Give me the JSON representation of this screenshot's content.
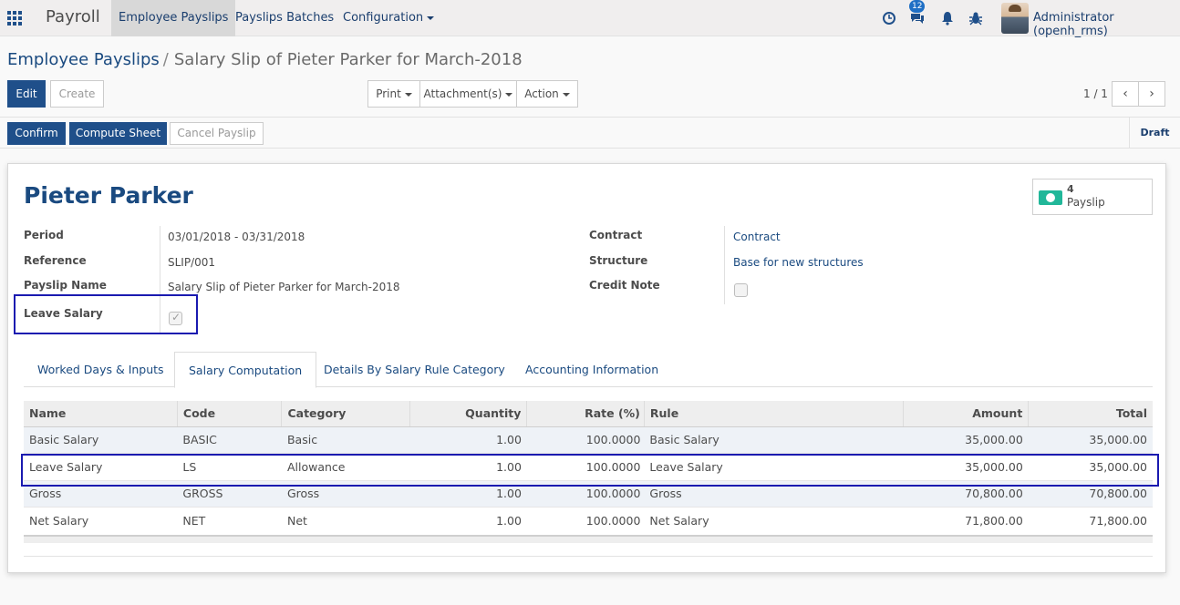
{
  "navbar": {
    "brand": "Payroll",
    "menus": [
      {
        "label": "Employee Payslips",
        "active": true
      },
      {
        "label": "Payslips Batches",
        "active": false
      },
      {
        "label": "Configuration",
        "dropdown": true
      }
    ],
    "icons": [
      "apps-grid-icon",
      "clock-icon",
      "chat-icon",
      "bell-icon",
      "bug-icon"
    ],
    "chat_badge": "12",
    "user": "Administrator (openh_rms)"
  },
  "breadcrumb": {
    "parent": "Employee Payslips",
    "separator": "/",
    "current": "Salary Slip of Pieter Parker for March-2018"
  },
  "toolbar": {
    "edit": "Edit",
    "create": "Create",
    "print": "Print",
    "attachments": "Attachment(s)",
    "action": "Action",
    "pager": "1 / 1",
    "prev": "‹",
    "next": "›"
  },
  "statusbar": {
    "confirm": "Confirm",
    "compute": "Compute Sheet",
    "cancel": "Cancel Payslip",
    "state": "Draft"
  },
  "sheet": {
    "title": "Pieter Parker",
    "stat_button": {
      "count": "4",
      "label": "Payslip",
      "icon": "money-icon"
    },
    "left_fields": [
      {
        "label": "Period",
        "value": "03/01/2018 - 03/31/2018"
      },
      {
        "label": "Reference",
        "value": "SLIP/001"
      },
      {
        "label": "Payslip Name",
        "value": "Salary Slip of Pieter Parker for March-2018"
      },
      {
        "label": "Leave Salary",
        "checked": true
      }
    ],
    "right_fields": [
      {
        "label": "Contract",
        "value": "Contract"
      },
      {
        "label": "Structure",
        "value": "Base for new structures"
      },
      {
        "label": "Credit Note",
        "checked": false
      }
    ]
  },
  "tabs": [
    {
      "label": "Worked Days & Inputs",
      "active": false
    },
    {
      "label": "Salary Computation",
      "active": true
    },
    {
      "label": "Details By Salary Rule Category",
      "active": false
    },
    {
      "label": "Accounting Information",
      "active": false
    }
  ],
  "table": {
    "headers": [
      "Name",
      "Code",
      "Category",
      "Quantity",
      "Rate (%)",
      "Rule",
      "Amount",
      "Total"
    ],
    "rows": [
      [
        "Basic Salary",
        "BASIC",
        "Basic",
        "1.00",
        "100.0000",
        "Basic Salary",
        "35,000.00",
        "35,000.00"
      ],
      [
        "Leave Salary",
        "LS",
        "Allowance",
        "1.00",
        "100.0000",
        "Leave Salary",
        "35,000.00",
        "35,000.00"
      ],
      [
        "Gross",
        "GROSS",
        "Gross",
        "1.00",
        "100.0000",
        "Gross",
        "70,800.00",
        "70,800.00"
      ],
      [
        "Net Salary",
        "NET",
        "Net",
        "1.00",
        "100.0000",
        "Net Salary",
        "71,800.00",
        "71,800.00"
      ]
    ]
  },
  "colors": {
    "primary": "#1f4f8a",
    "link": "#1a4a80",
    "highlight_border": "#1a1ab0",
    "stat_icon": "#21b799"
  }
}
